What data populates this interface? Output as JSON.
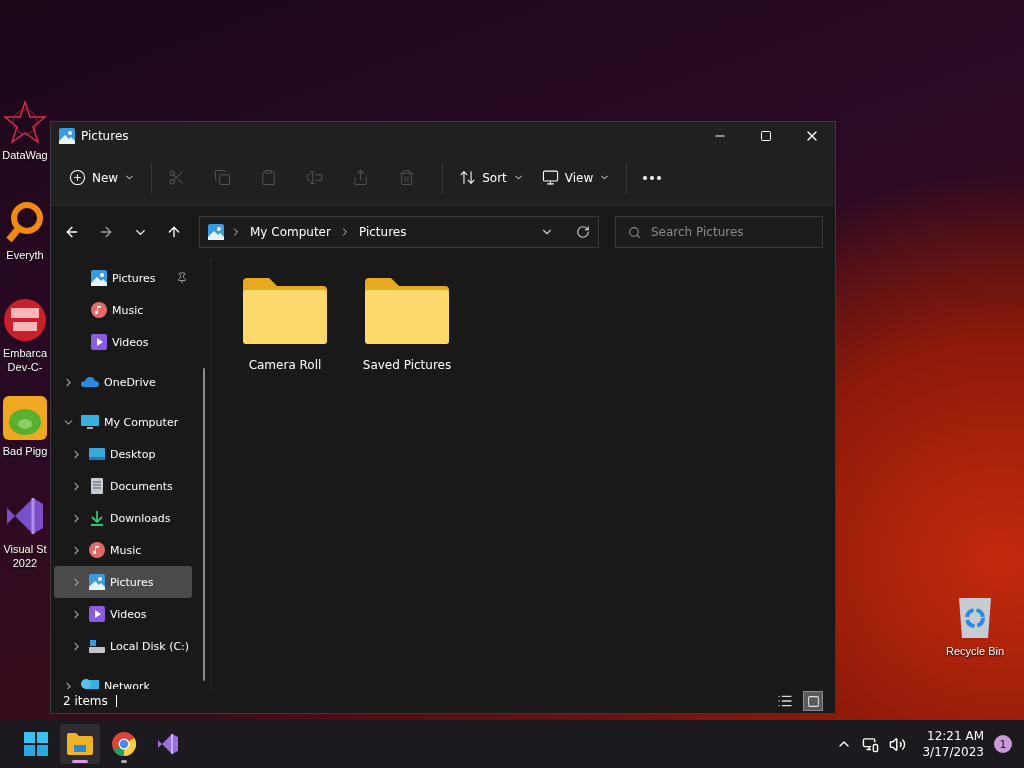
{
  "desktop_icons": [
    {
      "label": "DataWag",
      "kind": "star"
    },
    {
      "label": "Everyth",
      "kind": "search"
    },
    {
      "label": "Embarca Dev-C-",
      "kind": "dev"
    },
    {
      "label": "Bad Pigg",
      "kind": "game"
    },
    {
      "label": "Visual St 2022",
      "kind": "vs"
    }
  ],
  "recycle_bin": {
    "label": "Recycle Bin"
  },
  "window": {
    "title": "Pictures",
    "toolbar": [
      {
        "label": "New",
        "kind": "new",
        "disabled": false
      },
      {
        "kind": "cut",
        "disabled": true
      },
      {
        "kind": "copy",
        "disabled": true
      },
      {
        "kind": "paste",
        "disabled": true
      },
      {
        "kind": "rename",
        "disabled": true
      },
      {
        "kind": "share",
        "disabled": true
      },
      {
        "kind": "delete",
        "disabled": true
      },
      {
        "label": "Sort",
        "kind": "sort",
        "disabled": false
      },
      {
        "label": "View",
        "kind": "view",
        "disabled": false
      },
      {
        "kind": "more",
        "disabled": false
      }
    ],
    "address": {
      "crumbs": [
        "My Computer",
        "Pictures"
      ]
    },
    "search": {
      "placeholder": "Search Pictures"
    },
    "quick_access": [
      {
        "label": "Pictures",
        "kind": "pictures",
        "pinned": true
      },
      {
        "label": "Music",
        "kind": "music",
        "pinned": false
      },
      {
        "label": "Videos",
        "kind": "videos",
        "pinned": false
      }
    ],
    "tree": [
      {
        "label": "OneDrive",
        "kind": "onedrive",
        "expanded": false,
        "selected": false
      },
      {
        "label": "My Computer",
        "kind": "computer",
        "expanded": true,
        "selected": false,
        "children": [
          {
            "label": "Desktop",
            "kind": "desktop",
            "expanded": false,
            "selected": false
          },
          {
            "label": "Documents",
            "kind": "documents",
            "expanded": false,
            "selected": false
          },
          {
            "label": "Downloads",
            "kind": "downloads",
            "expanded": false,
            "selected": false
          },
          {
            "label": "Music",
            "kind": "music",
            "expanded": false,
            "selected": false
          },
          {
            "label": "Pictures",
            "kind": "pictures",
            "expanded": false,
            "selected": true
          },
          {
            "label": "Videos",
            "kind": "videos",
            "expanded": false,
            "selected": false
          },
          {
            "label": "Local Disk (C:)",
            "kind": "disk",
            "expanded": false,
            "selected": false
          }
        ]
      },
      {
        "label": "Network",
        "kind": "network",
        "expanded": false,
        "selected": false
      }
    ],
    "folders": [
      {
        "label": "Camera Roll"
      },
      {
        "label": "Saved Pictures"
      }
    ],
    "status_bar": {
      "count": "2 items",
      "views": [
        {
          "kind": "details",
          "selected": false
        },
        {
          "kind": "tiles",
          "selected": true
        }
      ]
    }
  },
  "taskbar": {
    "apps": [
      {
        "kind": "start",
        "running": false,
        "selected": false
      },
      {
        "kind": "explorer",
        "running": true,
        "selected": true
      },
      {
        "kind": "chrome",
        "running": true,
        "selected": false
      },
      {
        "kind": "vs",
        "running": false,
        "selected": false
      }
    ],
    "time": "12:21 AM",
    "date": "3/17/2023",
    "notifications": "1"
  }
}
